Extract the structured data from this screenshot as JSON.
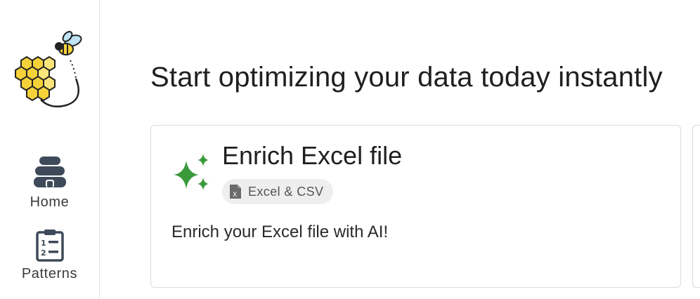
{
  "sidebar": {
    "logo_icon": "bee-honeycomb-logo",
    "items": [
      {
        "label": "Home",
        "icon": "beehive-icon"
      },
      {
        "label": "Patterns",
        "icon": "clipboard-list-icon"
      }
    ]
  },
  "main": {
    "title": "Start optimizing your data today instantly",
    "card": {
      "title": "Enrich Excel file",
      "icon": "sparkle-icon",
      "icon_color": "#3a9a3a",
      "tag": {
        "label": "Excel & CSV",
        "icon": "excel-file-icon"
      },
      "description": "Enrich your Excel file with AI!"
    }
  }
}
